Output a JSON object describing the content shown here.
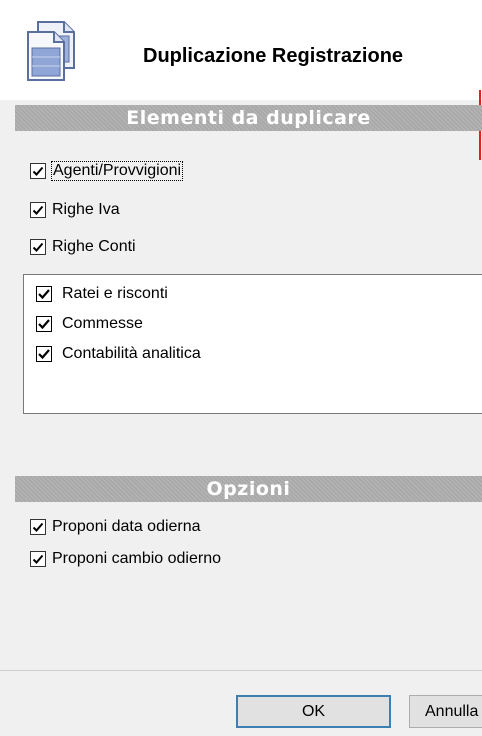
{
  "dialog": {
    "title": "Duplicazione Registrazione",
    "icon": "document-duplicate-icon"
  },
  "sections": {
    "elements_title": "Elementi da duplicare",
    "options_title": "Opzioni"
  },
  "elements": [
    {
      "label": "Agenti/Provvigioni",
      "checked": true
    },
    {
      "label": "Righe Iva",
      "checked": true
    },
    {
      "label": "Righe Conti",
      "checked": true
    }
  ],
  "sub_list": [
    {
      "label": "Ratei e risconti",
      "checked": true
    },
    {
      "label": "Commesse",
      "checked": true
    },
    {
      "label": "Contabilità analitica",
      "checked": true
    }
  ],
  "options": [
    {
      "label": "Proponi data odierna",
      "checked": true
    },
    {
      "label": "Proponi cambio odierno",
      "checked": true
    }
  ],
  "buttons": {
    "ok": "OK",
    "cancel": "Annulla"
  },
  "colors": {
    "section_bar": "#a9a9a9",
    "ok_border": "#3c7fb1",
    "red_line": "#e81d1d"
  }
}
